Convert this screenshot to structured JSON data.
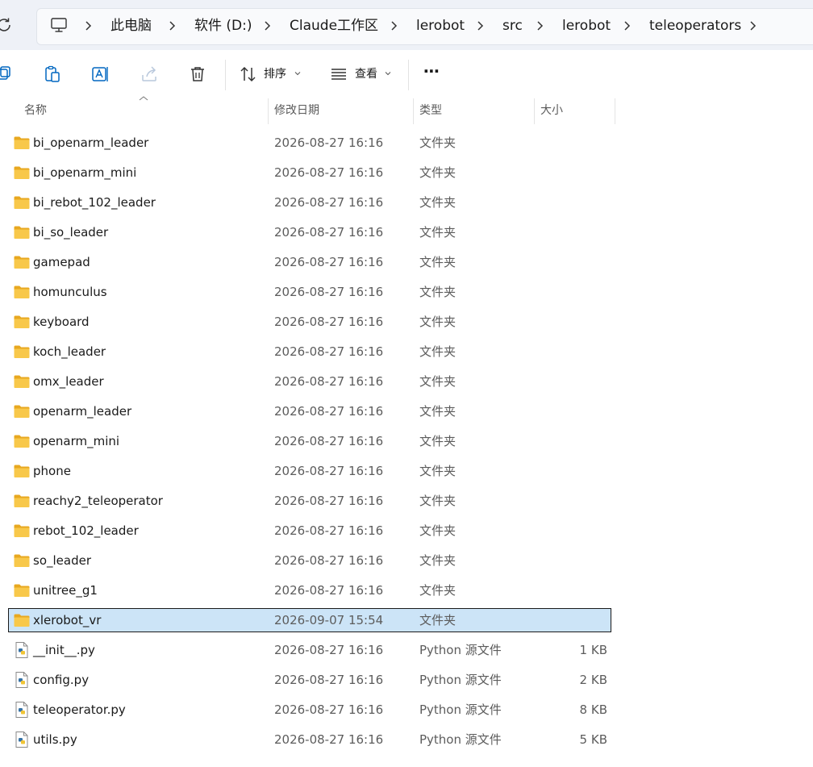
{
  "breadcrumb": {
    "items": [
      "此电脑",
      "软件 (D:)",
      "Claude工作区",
      "lerobot",
      "src",
      "lerobot",
      "teleoperators"
    ]
  },
  "toolbar": {
    "sort_label": "排序",
    "view_label": "查看",
    "more_label": "⋯"
  },
  "columns": {
    "name": "名称",
    "modified": "修改日期",
    "type": "类型",
    "size": "大小"
  },
  "files": [
    {
      "name": "bi_openarm_leader",
      "modified": "2026-08-27 16:16",
      "type": "文件夹",
      "size": "",
      "kind": "folder-icon"
    },
    {
      "name": "bi_openarm_mini",
      "modified": "2026-08-27 16:16",
      "type": "文件夹",
      "size": "",
      "kind": "folder-icon"
    },
    {
      "name": "bi_rebot_102_leader",
      "modified": "2026-08-27 16:16",
      "type": "文件夹",
      "size": "",
      "kind": "folder-icon"
    },
    {
      "name": "bi_so_leader",
      "modified": "2026-08-27 16:16",
      "type": "文件夹",
      "size": "",
      "kind": "folder-icon"
    },
    {
      "name": "gamepad",
      "modified": "2026-08-27 16:16",
      "type": "文件夹",
      "size": "",
      "kind": "folder-icon"
    },
    {
      "name": "homunculus",
      "modified": "2026-08-27 16:16",
      "type": "文件夹",
      "size": "",
      "kind": "folder-icon"
    },
    {
      "name": "keyboard",
      "modified": "2026-08-27 16:16",
      "type": "文件夹",
      "size": "",
      "kind": "folder-icon"
    },
    {
      "name": "koch_leader",
      "modified": "2026-08-27 16:16",
      "type": "文件夹",
      "size": "",
      "kind": "folder-icon"
    },
    {
      "name": "omx_leader",
      "modified": "2026-08-27 16:16",
      "type": "文件夹",
      "size": "",
      "kind": "folder-icon"
    },
    {
      "name": "openarm_leader",
      "modified": "2026-08-27 16:16",
      "type": "文件夹",
      "size": "",
      "kind": "folder-icon"
    },
    {
      "name": "openarm_mini",
      "modified": "2026-08-27 16:16",
      "type": "文件夹",
      "size": "",
      "kind": "folder-icon"
    },
    {
      "name": "phone",
      "modified": "2026-08-27 16:16",
      "type": "文件夹",
      "size": "",
      "kind": "folder-icon"
    },
    {
      "name": "reachy2_teleoperator",
      "modified": "2026-08-27 16:16",
      "type": "文件夹",
      "size": "",
      "kind": "folder-icon"
    },
    {
      "name": "rebot_102_leader",
      "modified": "2026-08-27 16:16",
      "type": "文件夹",
      "size": "",
      "kind": "folder-icon"
    },
    {
      "name": "so_leader",
      "modified": "2026-08-27 16:16",
      "type": "文件夹",
      "size": "",
      "kind": "folder-icon"
    },
    {
      "name": "unitree_g1",
      "modified": "2026-08-27 16:16",
      "type": "文件夹",
      "size": "",
      "kind": "folder-icon"
    },
    {
      "name": "xlerobot_vr",
      "modified": "2026-09-07 15:54",
      "type": "文件夹",
      "size": "",
      "kind": "folder-icon",
      "selected": true
    },
    {
      "name": "__init__.py",
      "modified": "2026-08-27 16:16",
      "type": "Python 源文件",
      "size": "1 KB",
      "kind": "python-file-icon"
    },
    {
      "name": "config.py",
      "modified": "2026-08-27 16:16",
      "type": "Python 源文件",
      "size": "2 KB",
      "kind": "python-file-icon"
    },
    {
      "name": "teleoperator.py",
      "modified": "2026-08-27 16:16",
      "type": "Python 源文件",
      "size": "8 KB",
      "kind": "python-file-icon"
    },
    {
      "name": "utils.py",
      "modified": "2026-08-27 16:16",
      "type": "Python 源文件",
      "size": "5 KB",
      "kind": "python-file-icon"
    }
  ],
  "colors": {
    "selection": "#cce4f7",
    "folder": "#f8c84a",
    "accent": "#0067c0"
  }
}
